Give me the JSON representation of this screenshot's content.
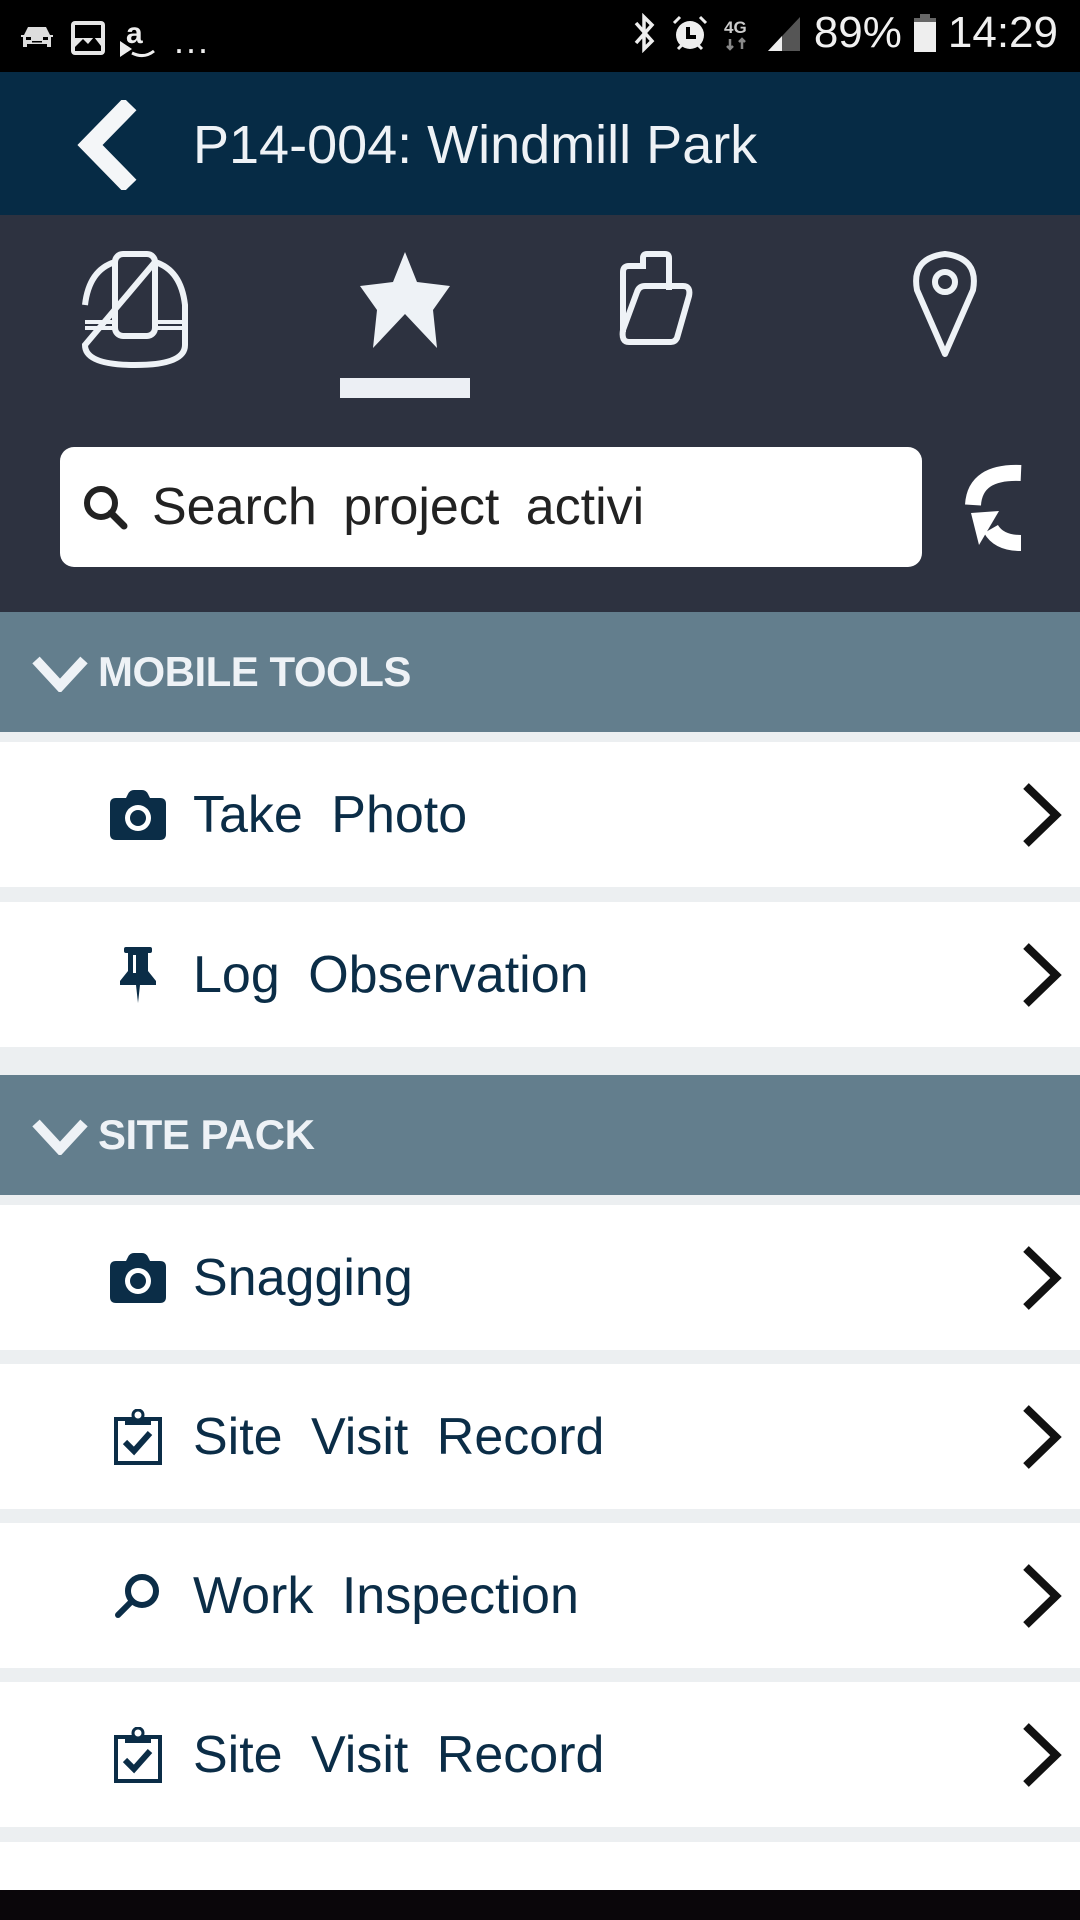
{
  "status_bar": {
    "left_icons": [
      "car-icon",
      "gallery-icon",
      "amazon-icon"
    ],
    "overflow": "...",
    "right_icons": [
      "bluetooth-icon",
      "alarm-icon",
      "network-4g-icon",
      "signal-icon"
    ],
    "network": "4G",
    "battery": "89%",
    "time": "14:29"
  },
  "app_bar": {
    "back_icon": "chevron-left-icon",
    "title": "P14-004: Windmill Park"
  },
  "tabs": [
    {
      "name": "site",
      "icon": "hard-hat-icon",
      "active": false
    },
    {
      "name": "favourites",
      "icon": "star-icon",
      "active": true
    },
    {
      "name": "documents",
      "icon": "folder-open-icon",
      "active": false
    },
    {
      "name": "location",
      "icon": "map-pin-icon",
      "active": false
    }
  ],
  "search": {
    "placeholder": "Search project activi",
    "value": "",
    "refresh_icon": "refresh-icon"
  },
  "sections": [
    {
      "title": "MOBILE TOOLS",
      "expanded": true,
      "items": [
        {
          "label": "Take Photo",
          "icon": "camera-icon"
        },
        {
          "label": "Log Observation",
          "icon": "pushpin-icon"
        }
      ]
    },
    {
      "title": "SITE PACK",
      "expanded": true,
      "items": [
        {
          "label": "Snagging",
          "icon": "camera-icon"
        },
        {
          "label": "Site Visit Record",
          "icon": "clipboard-check-icon"
        },
        {
          "label": "Work Inspection",
          "icon": "search-icon"
        },
        {
          "label": "Site Visit Record",
          "icon": "clipboard-check-icon"
        }
      ]
    }
  ],
  "colors": {
    "app_bar": "#062b45",
    "tab_bar": "#2d3240",
    "section_header": "#637e8d",
    "item_text": "#0b2d47",
    "separator": "#eceff1"
  }
}
